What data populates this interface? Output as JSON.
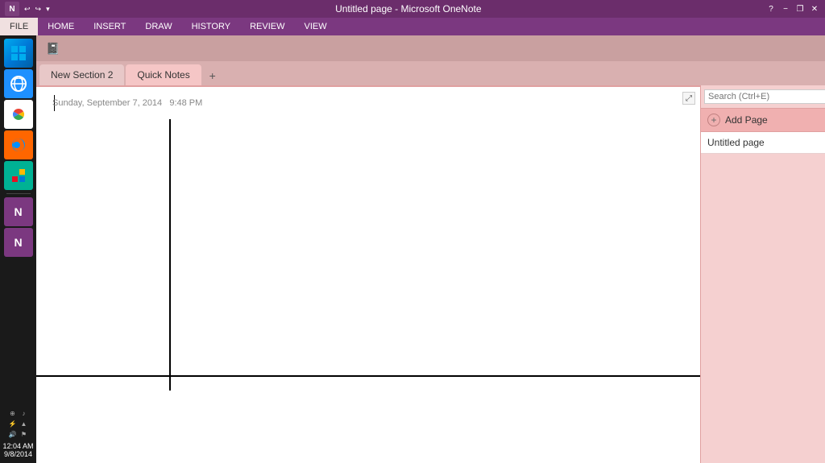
{
  "titleBar": {
    "appName": "Untitled page - Microsoft OneNote",
    "logo": "N",
    "helpBtn": "?",
    "minimizeBtn": "−",
    "restoreBtn": "❐",
    "closeBtn": "✕"
  },
  "ribbon": {
    "tabs": [
      {
        "id": "file",
        "label": "FILE",
        "active": true
      },
      {
        "id": "home",
        "label": "HOME",
        "active": false
      },
      {
        "id": "insert",
        "label": "INSERT",
        "active": false
      },
      {
        "id": "draw",
        "label": "DRAW",
        "active": false
      },
      {
        "id": "history",
        "label": "HISTORY",
        "active": false
      },
      {
        "id": "review",
        "label": "REVIEW",
        "active": false
      },
      {
        "id": "view",
        "label": "VIEW",
        "active": false
      }
    ]
  },
  "sections": {
    "tabs": [
      {
        "id": "new-section-2",
        "label": "New Section 2",
        "active": false
      },
      {
        "id": "quick-notes",
        "label": "Quick Notes",
        "active": true
      }
    ],
    "addLabel": "+"
  },
  "page": {
    "title": "",
    "date": "Sunday, September 7, 2014",
    "time": "9:48 PM"
  },
  "sidebar": {
    "search": {
      "placeholder": "Search (Ctrl+E)",
      "btnLabel": "🔍"
    },
    "addPageLabel": "Add Page",
    "pages": [
      {
        "title": "Untitled page"
      }
    ]
  },
  "taskbar": {
    "clock": {
      "time": "12:04 AM",
      "date": "9/8/2014"
    }
  }
}
